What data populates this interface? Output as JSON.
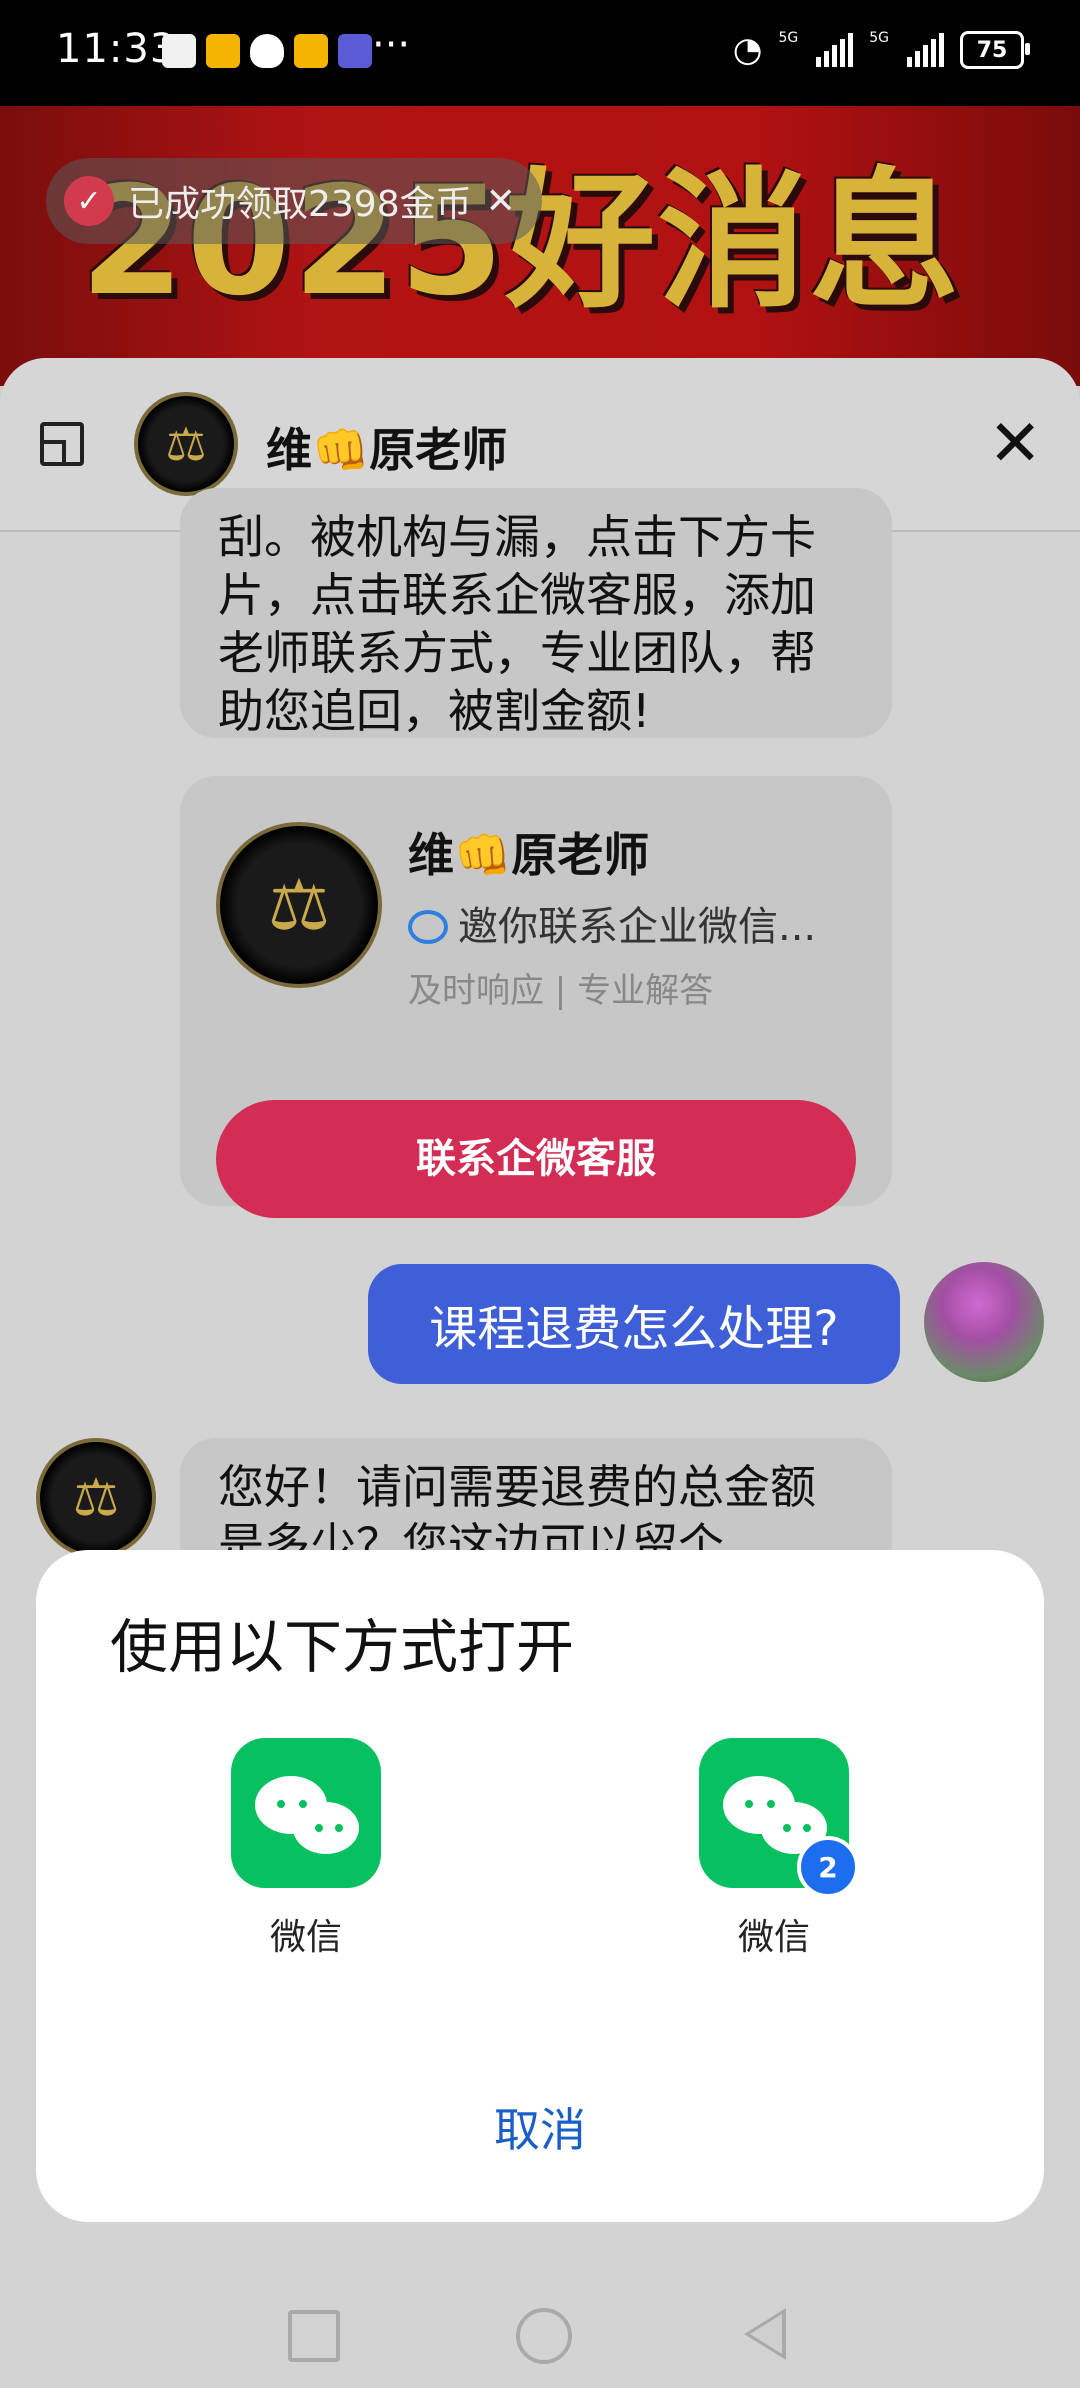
{
  "status": {
    "time": "11:33",
    "battery": "75",
    "network_a": "5G",
    "network_b": "5G",
    "more": "···"
  },
  "banner": {
    "title": "2025好消息",
    "toast": "已成功领取2398金币"
  },
  "chat": {
    "header": {
      "name": "维👊原老师"
    },
    "message_top": "刮。被机构与漏，点击下方卡片，点击联系企微客服，添加老师联系方式，专业团队，帮助您追回，被割金额!",
    "card": {
      "name": "维👊原老师",
      "subtitle": "邀你联系企业微信...",
      "tags": "及时响应 | 专业解答",
      "button": "联系企微客服"
    },
    "user_message": "课程退费怎么处理?",
    "reply": "您好！请问需要退费的总金额是多少？您这边可以留个"
  },
  "dialog": {
    "title": "使用以下方式打开",
    "apps": [
      {
        "label": "微信",
        "icon": "wechat-icon"
      },
      {
        "label": "微信",
        "icon": "wechat-clone-icon",
        "badge": "2"
      }
    ],
    "cancel": "取消"
  },
  "colors": {
    "accent_red": "#d32d56",
    "user_bubble": "#3e5fd8",
    "wechat_green": "#07c160",
    "link_blue": "#1a5fc9"
  }
}
